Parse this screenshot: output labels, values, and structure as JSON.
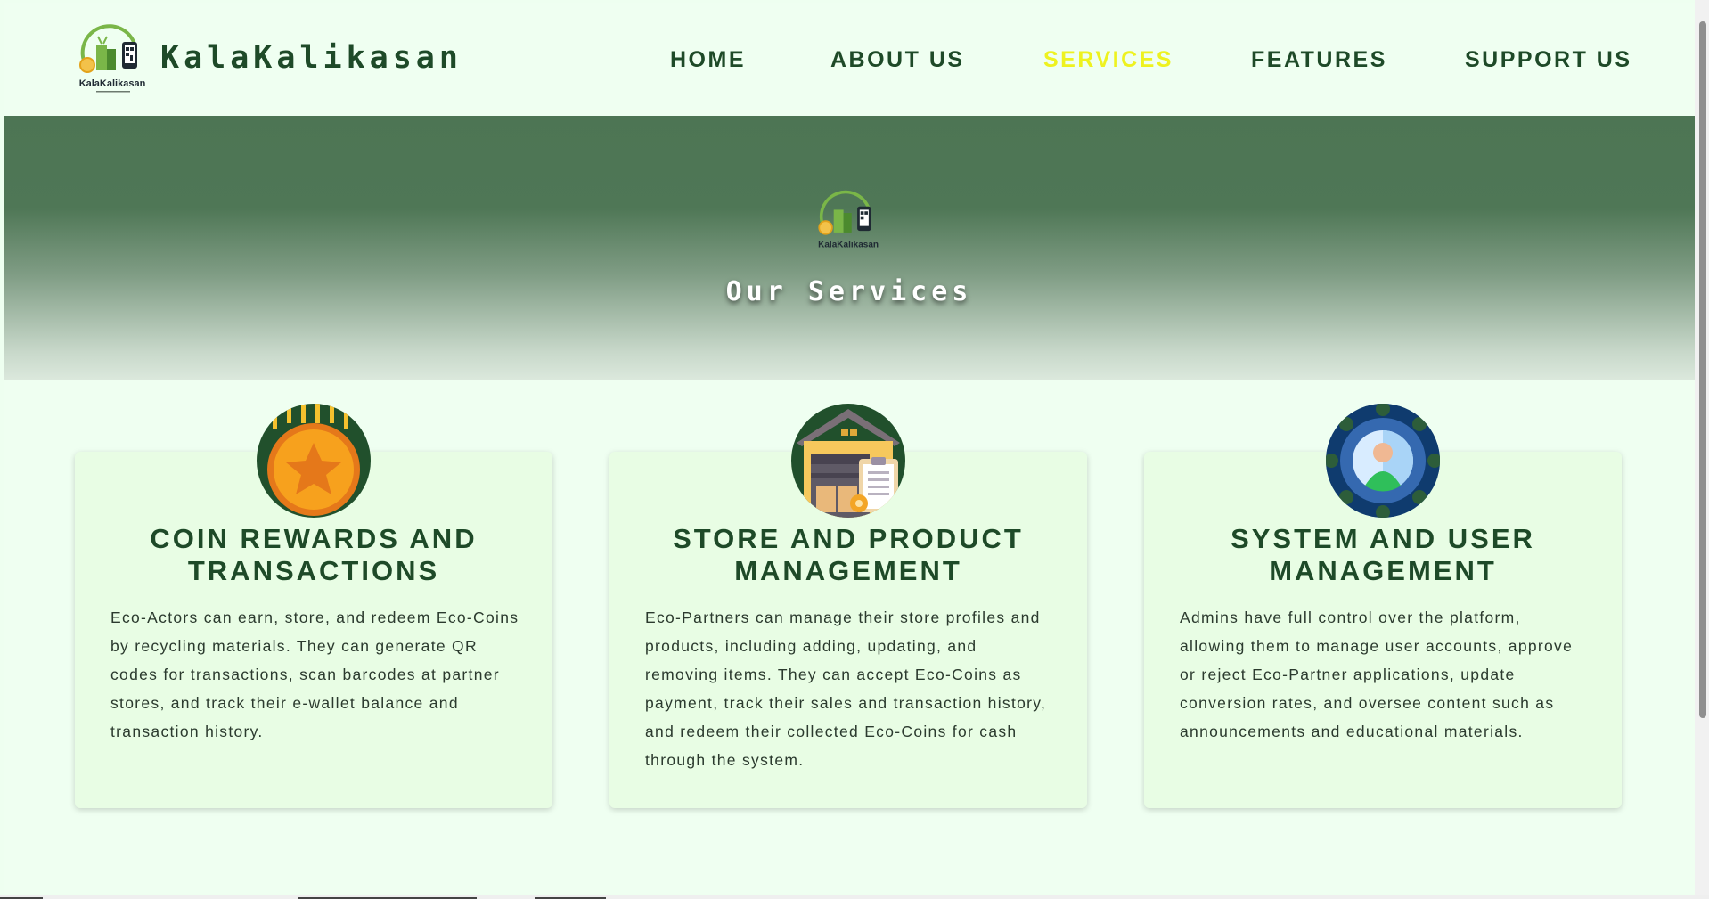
{
  "brand": {
    "name": "KalaKalikasan",
    "logo_wordmark": "KalaKalikasan",
    "logo_tagline": "Turn your trash into cash"
  },
  "nav": {
    "items": [
      {
        "label": "HOME"
      },
      {
        "label": "ABOUT US"
      },
      {
        "label": "SERVICES",
        "active": true
      },
      {
        "label": "FEATURES"
      },
      {
        "label": "SUPPORT US"
      }
    ]
  },
  "hero": {
    "title": "Our Services"
  },
  "services": [
    {
      "icon": "coin-star-icon",
      "title": "COIN REWARDS AND TRANSACTIONS",
      "text": "Eco-Actors can earn, store, and redeem Eco-Coins by recycling materials. They can generate QR codes for transactions, scan barcodes at partner stores, and track their e-wallet balance and transaction history."
    },
    {
      "icon": "store-warehouse-icon",
      "title": "STORE AND PRODUCT MANAGEMENT",
      "text": "Eco-Partners can manage their store profiles and products, including adding, updating, and removing items. They can accept Eco-Coins as payment, track their sales and transaction history, and redeem their collected Eco-Coins for cash through the system."
    },
    {
      "icon": "user-admin-icon",
      "title": "SYSTEM AND USER MANAGEMENT",
      "text": "Admins have full control over the platform, allowing them to manage user accounts, approve or reject Eco-Partner applications, update conversion rates, and oversee content such as announcements and educational materials."
    }
  ],
  "colors": {
    "page_bg": "#effff1",
    "brand_green": "#1e4a28",
    "nav_active": "#eef21f",
    "card_bg": "#e8fde4",
    "hero_top": "#4d7554"
  }
}
